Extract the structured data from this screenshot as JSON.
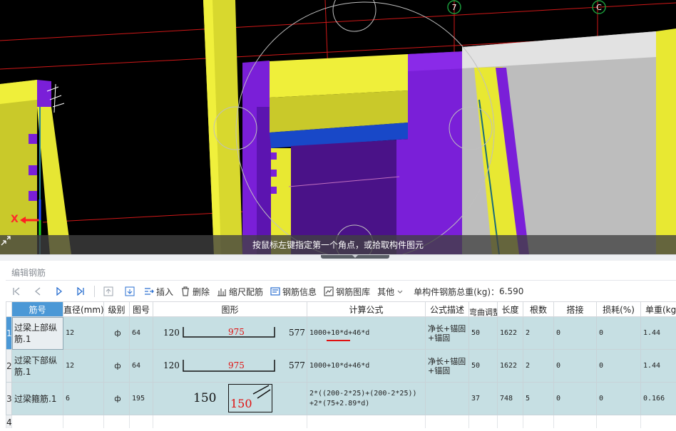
{
  "viewport": {
    "status_text": "按鼠标左键指定第一个角点，或拾取构件图元",
    "grid_labels": [
      "7",
      "C"
    ],
    "axis_label": "X"
  },
  "panel": {
    "title": "编辑钢筋"
  },
  "toolbar": {
    "insert": "插入",
    "delete": "删除",
    "scale_rebar": "缩尺配筋",
    "rebar_info": "钢筋信息",
    "rebar_library": "钢筋图库",
    "other": "其他",
    "total_weight_label": "单构件钢筋总重(kg)：",
    "total_weight_value": "6.590"
  },
  "table": {
    "headers": [
      "筋号",
      "直径(mm)",
      "级别",
      "图号",
      "图形",
      "计算公式",
      "公式描述",
      "弯曲调整",
      "长度",
      "根数",
      "搭接",
      "损耗(%)",
      "单重(kg)"
    ],
    "rows": [
      {
        "num": "1",
        "name": "过梁上部纵筋.1",
        "diameter": "12",
        "grade": "ф",
        "figure_no": "64",
        "shape": {
          "left": "120",
          "mid": "975",
          "right": "577"
        },
        "formula": "1000+10*d+46*d",
        "desc": "净长+锚固+锚固",
        "bend_adjust": "50",
        "length": "1622",
        "count": "2",
        "lap": "0",
        "loss": "0",
        "unit_weight": "1.44"
      },
      {
        "num": "2",
        "name": "过梁下部纵筋.1",
        "diameter": "12",
        "grade": "ф",
        "figure_no": "64",
        "shape": {
          "left": "120",
          "mid": "975",
          "right": "577"
        },
        "formula": "1000+10*d+46*d",
        "desc": "净长+锚固+锚固",
        "bend_adjust": "50",
        "length": "1622",
        "count": "2",
        "lap": "0",
        "loss": "0",
        "unit_weight": "1.44"
      },
      {
        "num": "3",
        "name": "过梁箍筋.1",
        "diameter": "6",
        "grade": "ф",
        "figure_no": "195",
        "shape": {
          "left": "150",
          "inner": "150"
        },
        "formula_line1": "2*((200-2*25)+(200-2*25))",
        "formula_line2": "+2*(75+2.89*d)",
        "desc": "",
        "bend_adjust": "37",
        "length": "748",
        "count": "5",
        "lap": "0",
        "loss": "0",
        "unit_weight": "0.166"
      }
    ],
    "empty_row_num": "4"
  },
  "colors": {
    "selection_blue": "#4b98d6",
    "row_fill": "#c6dfe3",
    "beam_yellow": "#e8e832",
    "column_purple": "#7a1fd8"
  }
}
